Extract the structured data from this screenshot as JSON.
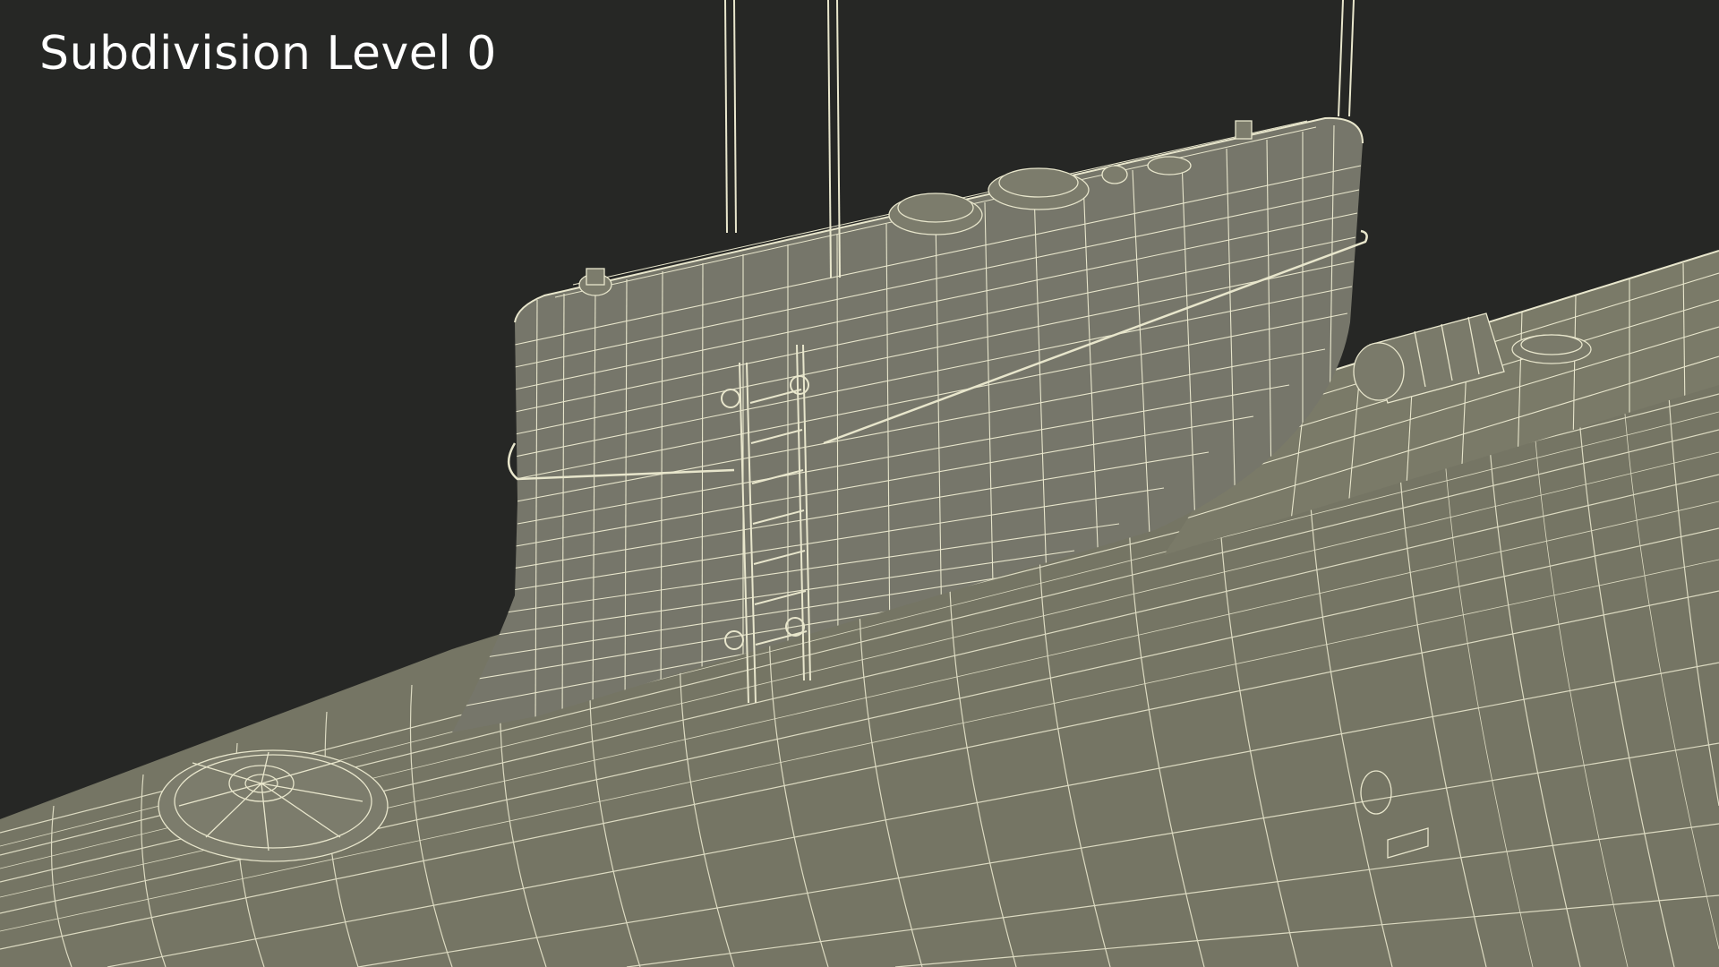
{
  "caption": "Subdivision Level 0",
  "colors": {
    "background": "#262725",
    "surface": "#757564",
    "surface_dark": "#686858",
    "wire": "#e8e6cc",
    "caption_text": "#ffffff"
  }
}
